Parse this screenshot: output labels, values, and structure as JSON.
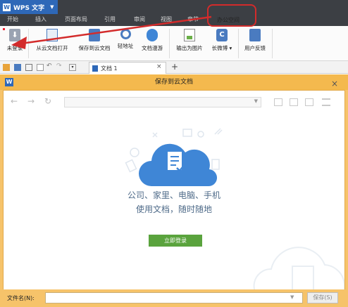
{
  "app": {
    "name": "WPS 文字",
    "logo_letter": "W"
  },
  "tabs": [
    {
      "label": "开始",
      "active": false
    },
    {
      "label": "插入",
      "active": false
    },
    {
      "label": "页面布局",
      "active": false
    },
    {
      "label": "引用",
      "active": false
    },
    {
      "label": "审阅",
      "active": false
    },
    {
      "label": "视图",
      "active": false
    },
    {
      "label": "章节",
      "active": false
    },
    {
      "label": "办公空间",
      "active": true
    }
  ],
  "toolbar": [
    {
      "label": "未登录",
      "icon": "download-icon"
    },
    {
      "label": "从云文档打开",
      "icon": "cloud-open-icon"
    },
    {
      "label": "保存到云文档",
      "icon": "cloud-save-icon"
    },
    {
      "label": "轻地址",
      "icon": "link-icon"
    },
    {
      "label": "文档漫游",
      "icon": "roaming-icon"
    },
    {
      "label": "输出为图片",
      "icon": "image-export-icon"
    },
    {
      "label": "长微博",
      "icon": "weibo-icon"
    },
    {
      "label": "用户反馈",
      "icon": "feedback-icon"
    }
  ],
  "document_tab": {
    "label": "文档 1",
    "close": "×",
    "new_tab": "+"
  },
  "dialog": {
    "title": "保存到云文档",
    "icon_letter": "W",
    "close": "×",
    "line1": "公司、家里、电脑、手机",
    "line2": "使用文档，随时随地",
    "login_button": "立即登录",
    "filename_label": "文件名(N):",
    "filename_value": "",
    "save_button": "保存(S)"
  },
  "colors": {
    "titlebar": "#3c3f44",
    "app_button": "#2e68b8",
    "dialog_frame": "#f6c36a",
    "login_button": "#5aa33d",
    "annotation": "#d32b2b",
    "cloud": "#3f86d6"
  }
}
